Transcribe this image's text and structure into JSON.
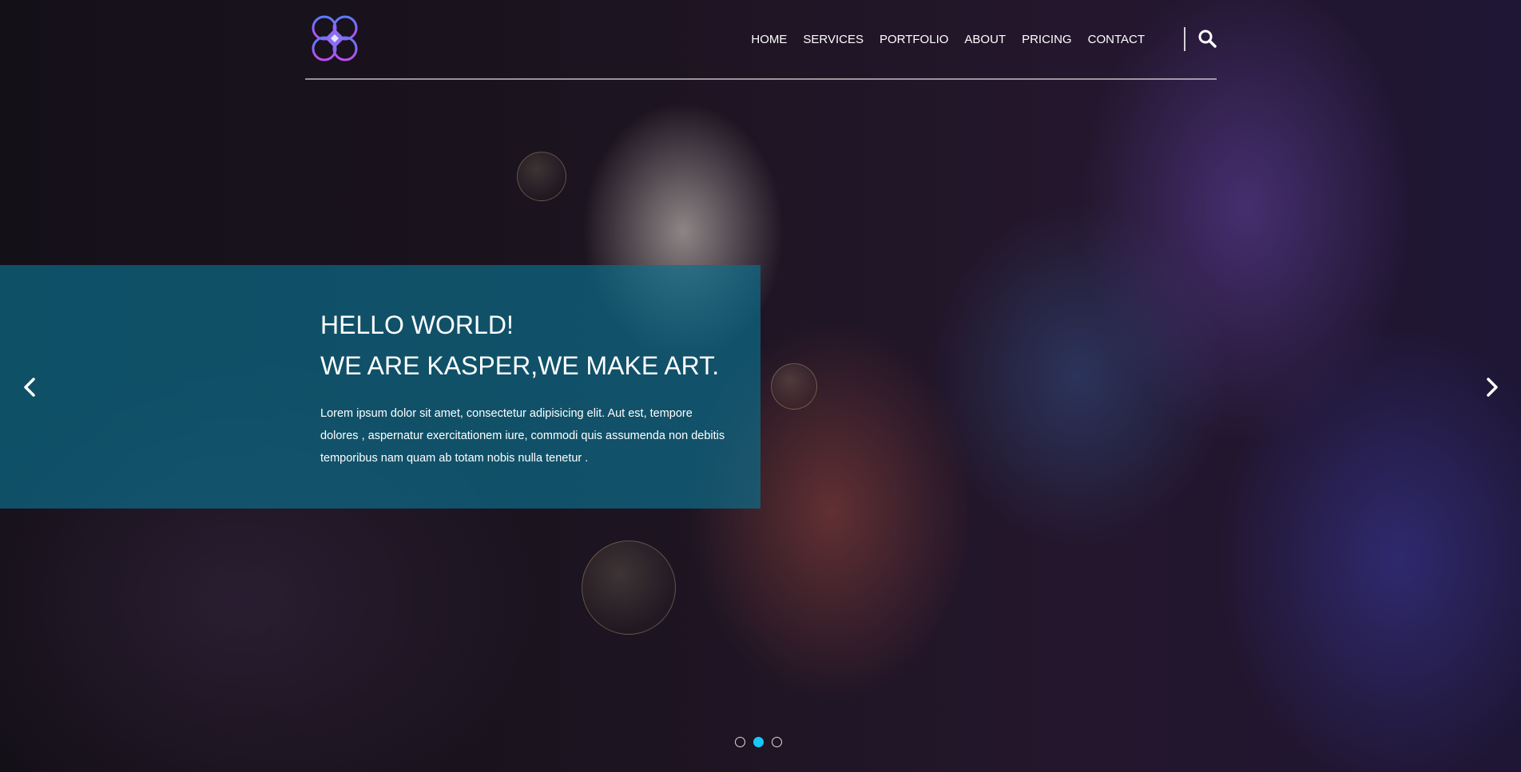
{
  "colors": {
    "accent": "#19c8fa",
    "caption_bg": "#0c6e8c",
    "text": "#ffffff"
  },
  "header": {
    "logo_icon": "kasper-logo-icon",
    "nav": [
      {
        "label": "HOME",
        "active": true
      },
      {
        "label": "SERVICES",
        "active": false
      },
      {
        "label": "PORTFOLIO",
        "active": false
      },
      {
        "label": "ABOUT",
        "active": false
      },
      {
        "label": "PRICING",
        "active": false
      },
      {
        "label": "CONTACT",
        "active": false
      }
    ],
    "search_icon": "search-icon"
  },
  "slider": {
    "title_line1": "HELLO WORLD!",
    "title_line2": "WE ARE KASPER,WE MAKE ART.",
    "description": "Lorem ipsum dolor sit amet, consectetur adipisicing elit. Aut est, tempore dolores , aspernatur exercitationem iure, commodi quis assumenda non debitis temporibus nam quam ab totam nobis nulla tenetur .",
    "prev_icon": "chevron-left-icon",
    "next_icon": "chevron-right-icon",
    "indicators": [
      {
        "active": false
      },
      {
        "active": true
      },
      {
        "active": false
      }
    ]
  }
}
